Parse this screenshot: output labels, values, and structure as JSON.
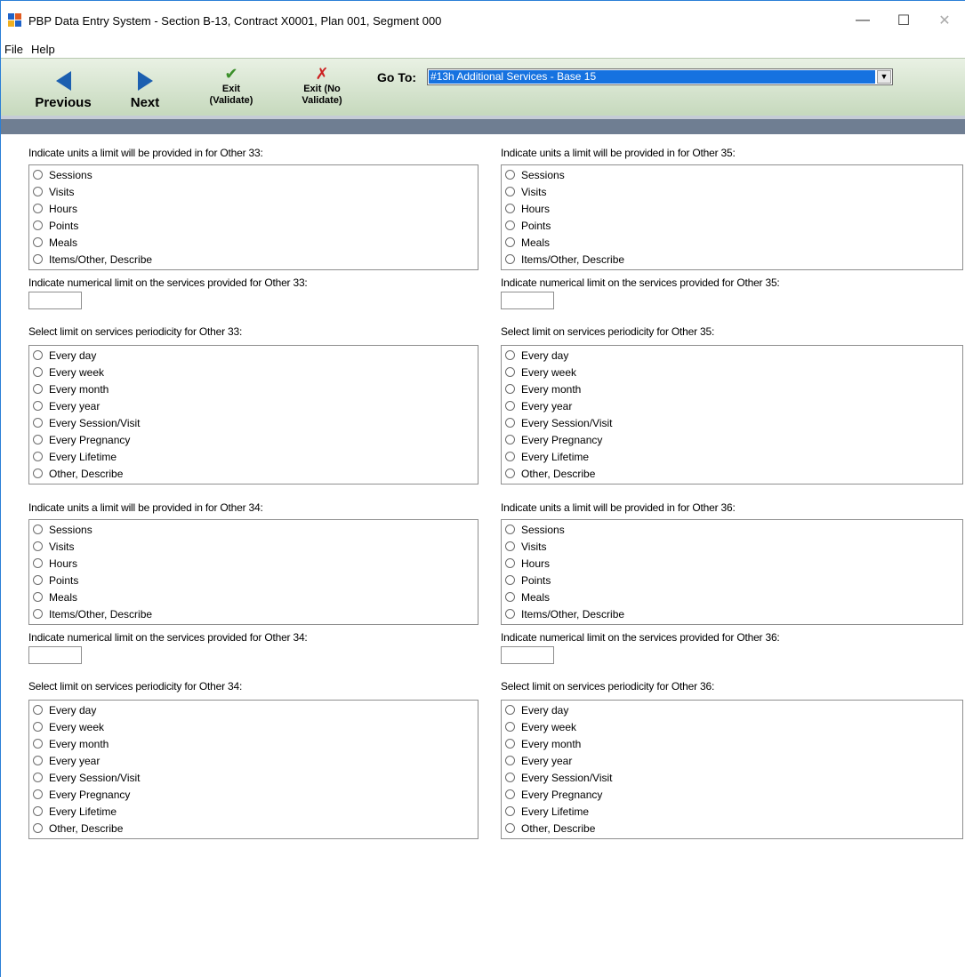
{
  "window": {
    "title": "PBP Data Entry System - Section B-13, Contract X0001, Plan 001, Segment 000",
    "minimize": "—",
    "maximize": "☐",
    "close": "✕"
  },
  "menu": [
    "File",
    "Help"
  ],
  "toolbar": {
    "previous": "Previous",
    "next": "Next",
    "exit_validate": [
      "Exit",
      "(Validate)"
    ],
    "exit_no_validate": [
      "Exit (No",
      "Validate)"
    ],
    "goto_label": "Go To:",
    "goto_value": "#13h Additional Services - Base 15"
  },
  "units_options": [
    "Sessions",
    "Visits",
    "Hours",
    "Points",
    "Meals",
    "Items/Other, Describe"
  ],
  "periodicity_options": [
    "Every day",
    "Every week",
    "Every month",
    "Every year",
    "Every Session/Visit",
    "Every Pregnancy",
    "Every Lifetime",
    "Other, Describe"
  ],
  "sections": {
    "o33": {
      "units_label": "Indicate units a limit will be provided in for Other 33:",
      "numerical_label": "Indicate numerical limit on the services provided for Other 33:",
      "numerical_value": "",
      "periodicity_label": "Select limit on services periodicity for Other 33:"
    },
    "o34": {
      "units_label": "Indicate units a limit will be provided in for Other 34:",
      "numerical_label": "Indicate numerical limit on the services provided for Other 34:",
      "numerical_value": "",
      "periodicity_label": "Select limit on services periodicity for Other 34:"
    },
    "o35": {
      "units_label": "Indicate units a limit will be provided in for Other 35:",
      "numerical_label": "Indicate numerical limit on the services provided for Other 35:",
      "numerical_value": "",
      "periodicity_label": "Select limit on services periodicity for Other 35:"
    },
    "o36": {
      "units_label": "Indicate units a limit will be provided in for Other 36:",
      "numerical_label": "Indicate numerical limit on the services provided for Other 36:",
      "numerical_value": "",
      "periodicity_label": "Select limit on services periodicity for Other 36:"
    }
  },
  "colors": {
    "toolbar_top": "#e9f1e4",
    "toolbar_bottom": "#c6d9bd",
    "strip": "#6f7e92",
    "selection": "#1672e0",
    "arrow": "#1c5fb0"
  }
}
